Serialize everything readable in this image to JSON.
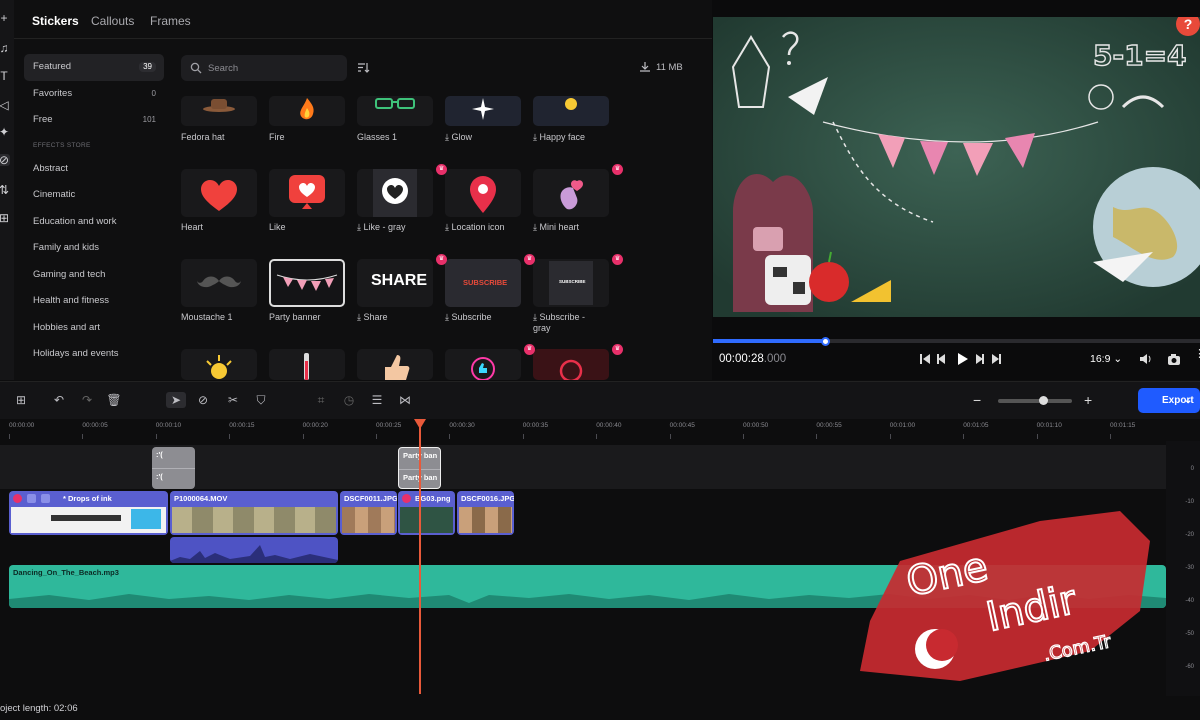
{
  "rail_icons": [
    "plus-icon",
    "music-icon",
    "text-icon",
    "transition-icon",
    "effects-icon",
    "sticker-icon",
    "filters-icon",
    "apps-icon"
  ],
  "tabs": {
    "stickers": "Stickers",
    "callouts": "Callouts",
    "frames": "Frames"
  },
  "categories": [
    {
      "label": "Featured",
      "count": "39"
    },
    {
      "label": "Favorites",
      "count": "0"
    },
    {
      "label": "Free",
      "count": "101"
    }
  ],
  "effects_store_header": "EFFECTS STORE",
  "store_categories": [
    "Abstract",
    "Cinematic",
    "Education and work",
    "Family and kids",
    "Gaming and tech",
    "Health and fitness",
    "Hobbies and art",
    "Holidays and events"
  ],
  "search": {
    "placeholder": "Search"
  },
  "download_size": "11 MB",
  "stickers": [
    {
      "label": "Fedora hat",
      "download": false,
      "premium": false
    },
    {
      "label": "Fire",
      "download": false,
      "premium": false
    },
    {
      "label": "Glasses 1",
      "download": false,
      "premium": false
    },
    {
      "label": "Glow",
      "download": true,
      "premium": false
    },
    {
      "label": "Happy face",
      "download": true,
      "premium": false
    },
    {
      "label": "Heart",
      "download": false,
      "premium": false
    },
    {
      "label": "Like",
      "download": false,
      "premium": false
    },
    {
      "label": "Like - gray",
      "download": true,
      "premium": true
    },
    {
      "label": "Location icon",
      "download": true,
      "premium": false
    },
    {
      "label": "Mini heart",
      "download": true,
      "premium": true
    },
    {
      "label": "Moustache 1",
      "download": false,
      "premium": false
    },
    {
      "label": "Party banner",
      "download": false,
      "premium": false
    },
    {
      "label": "Share",
      "download": true,
      "premium": true
    },
    {
      "label": "Subscribe",
      "download": true,
      "premium": true
    },
    {
      "label": "Subscribe - gray",
      "download": true,
      "premium": true
    }
  ],
  "sticker_thumb_text": {
    "share": "SHARE",
    "subscribe": "SUBSCRIBE",
    "subscribe_small": "SUBSCRIBE"
  },
  "preview": {
    "help": "?",
    "chalk_text": "5-1=4",
    "time_main": "00:00:28",
    "time_frac": ".000",
    "aspect": "16:9",
    "progress": 0.23
  },
  "timeline": {
    "ticks": [
      "00:00:00",
      "00:00:05",
      "00:00:10",
      "00:00:15",
      "00:00:20",
      "00:00:25",
      "00:00:30",
      "00:00:35",
      "00:00:40",
      "00:00:45",
      "00:00:50",
      "00:00:55",
      "00:01:00",
      "00:01:05",
      "00:01:10",
      "00:01:15"
    ],
    "overlay_clips": [
      {
        "top": ":'(",
        "bottom": ":'("
      },
      {
        "top": "Party ban",
        "bottom": "Party ban"
      }
    ],
    "video_clips": [
      "* Drops of ink",
      "P1000064.MOV",
      "DSCF0011.JPG",
      "BG03.png",
      "DSCF0016.JPG"
    ],
    "audio_clip": "Dancing_On_The_Beach.mp3",
    "meter_labels": [
      "0",
      "-10",
      "-20",
      "-30",
      "-40",
      "-50",
      "-60"
    ],
    "export_label": "Export",
    "project_length": "oject length: 02:06"
  },
  "watermark": {
    "line1": "One",
    "line2": "Indir",
    "line3": ".Com.Tr"
  },
  "colors": {
    "accent": "#1f5bff",
    "premium": "#e8306a",
    "video_clip": "#5a5fd0",
    "audio_clip": "#2fb89b",
    "playhead": "#e8593a"
  }
}
